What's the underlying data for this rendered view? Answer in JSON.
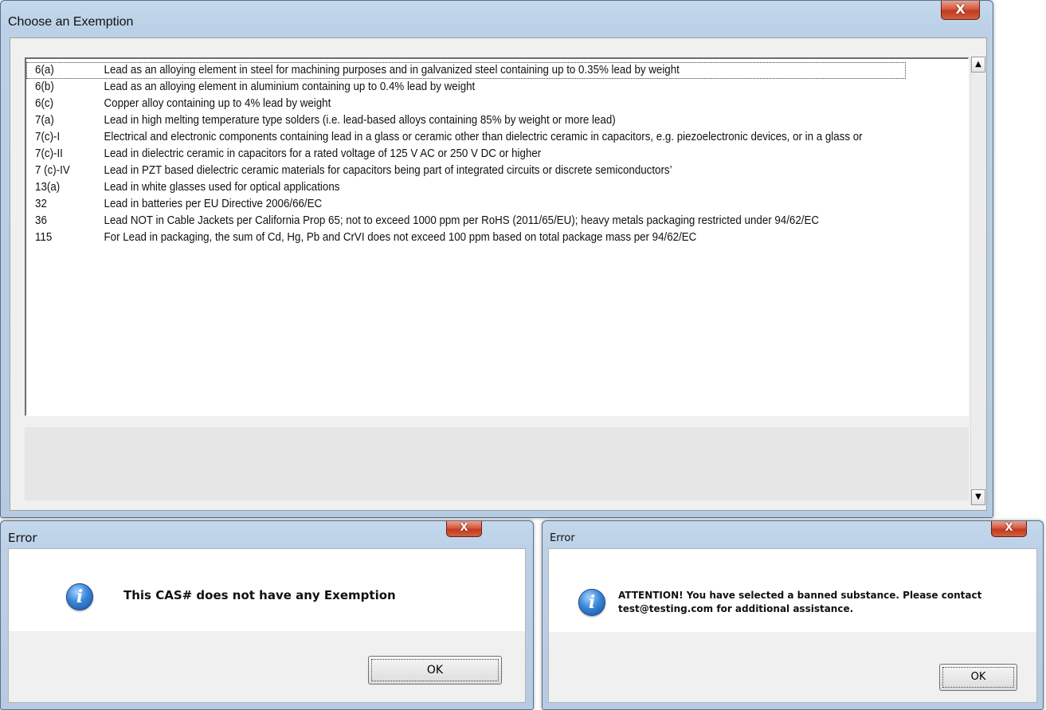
{
  "exemption_window": {
    "title": "Choose an Exemption",
    "close_label": "X",
    "items": [
      {
        "code": "6(a)",
        "desc": "Lead as an alloying element in steel for machining purposes and in galvanized steel containing up to 0.35% lead by weight"
      },
      {
        "code": "6(b)",
        "desc": "Lead as an alloying element in aluminium containing up to 0.4% lead by weight"
      },
      {
        "code": "6(c)",
        "desc": "Copper alloy containing up to 4% lead by weight"
      },
      {
        "code": "7(a)",
        "desc": "Lead in high melting temperature type solders (i.e. lead-based alloys containing 85% by weight or more lead)"
      },
      {
        "code": "7(c)-I",
        "desc": "Electrical and electronic components containing lead in a glass or ceramic other than dielectric ceramic in capacitors, e.g. piezoelectronic devices, or in a glass or"
      },
      {
        "code": "7(c)-II",
        "desc": "Lead in dielectric ceramic in capacitors for a rated voltage of 125 V AC or 250 V DC or higher"
      },
      {
        "code": "7 (c)-IV",
        "desc": "Lead in PZT based dielectric ceramic materials for capacitors being part of integrated circuits or discrete semiconductors’"
      },
      {
        "code": "13(a)",
        "desc": "Lead in white glasses used for optical applications"
      },
      {
        "code": "32",
        "desc": "Lead in batteries per EU Directive 2006/66/EC"
      },
      {
        "code": "36",
        "desc": "Lead NOT in Cable Jackets per California Prop 65; not to exceed 1000 ppm per RoHS (2011/65/EU); heavy metals packaging restricted under 94/62/EC"
      },
      {
        "code": "115",
        "desc": "For Lead in packaging, the sum of Cd, Hg, Pb and CrVI does not exceed 100 ppm based on total package mass per 94/62/EC"
      }
    ],
    "scroll_up_icon": "▲",
    "scroll_down_icon": "▼"
  },
  "error_dialog_1": {
    "title": "Error",
    "close_label": "X",
    "icon": "i",
    "message": "This CAS# does not have any Exemption",
    "ok_label": "OK"
  },
  "error_dialog_2": {
    "title": "Error",
    "close_label": "X",
    "icon": "i",
    "message_line1": "ATTENTION! You have selected a banned substance. Please contact",
    "message_line2": "test@testing.com for additional assistance.",
    "ok_label": "OK"
  }
}
